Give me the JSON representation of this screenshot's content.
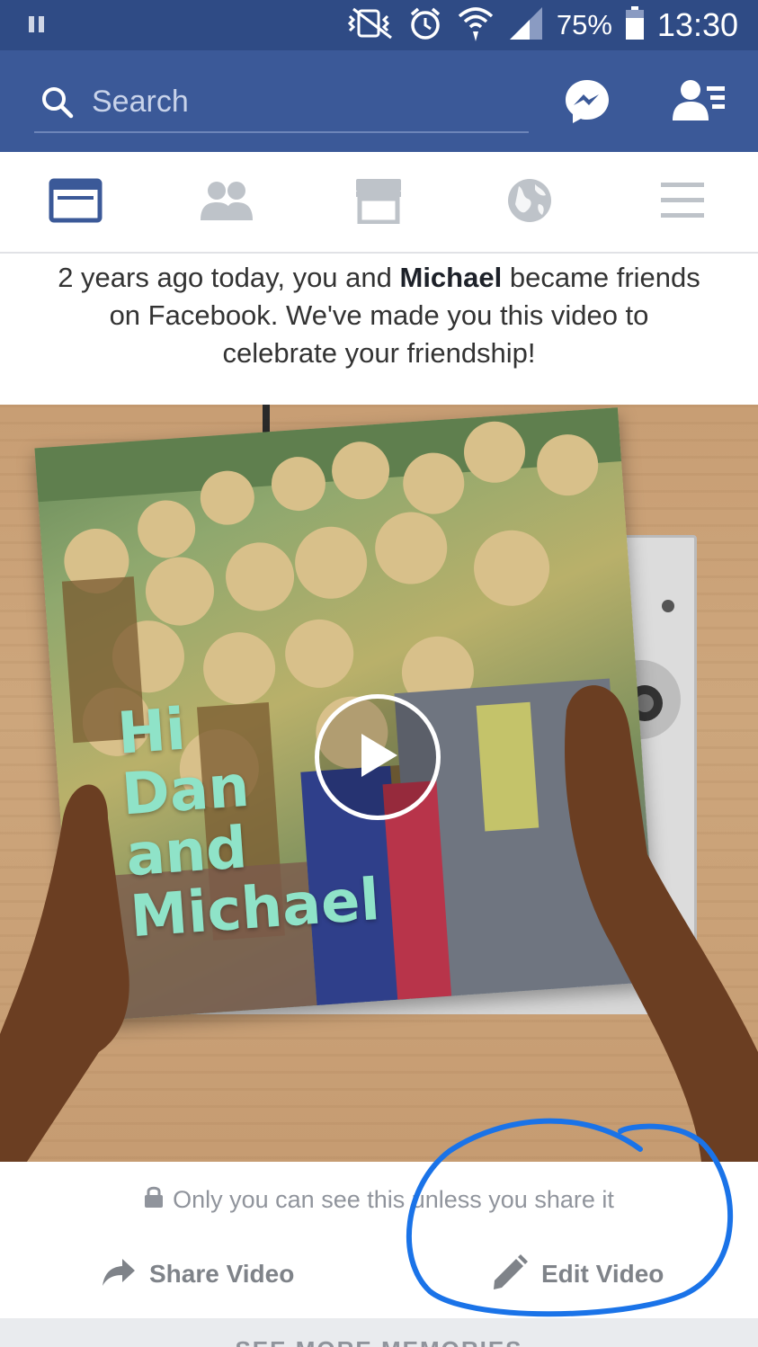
{
  "status_bar": {
    "battery": "75%",
    "time": "13:30",
    "icons": [
      "pause-icon",
      "vibrate-off-icon",
      "alarm-icon",
      "wifi-icon",
      "signal-icon",
      "battery-icon"
    ]
  },
  "header": {
    "search_placeholder": "Search",
    "icons": [
      "search-icon",
      "messenger-icon",
      "friend-requests-icon"
    ],
    "color": "#3b5998"
  },
  "tabs": [
    {
      "name": "news-feed",
      "icon": "news-feed-icon",
      "active": true
    },
    {
      "name": "friends",
      "icon": "friends-icon",
      "active": false
    },
    {
      "name": "marketplace",
      "icon": "marketplace-icon",
      "active": false
    },
    {
      "name": "notifications",
      "icon": "globe-icon",
      "active": false
    },
    {
      "name": "menu",
      "icon": "menu-icon",
      "active": false
    }
  ],
  "memory": {
    "text_before": "2 years ago today, you and ",
    "friend_name": "Michael",
    "text_after": " became friends on Facebook. We've made you this video to celebrate your friendship!"
  },
  "video": {
    "album_title_line1": "Hi",
    "album_title_line2": "Dan",
    "album_title_line3": "and",
    "album_title_line4": "Michael"
  },
  "privacy_note": "Only you can see this unless you share it",
  "actions": {
    "share_label": "Share Video",
    "edit_label": "Edit Video"
  },
  "see_more": "SEE MORE MEMORIES",
  "annotation_color": "#1a73e8"
}
